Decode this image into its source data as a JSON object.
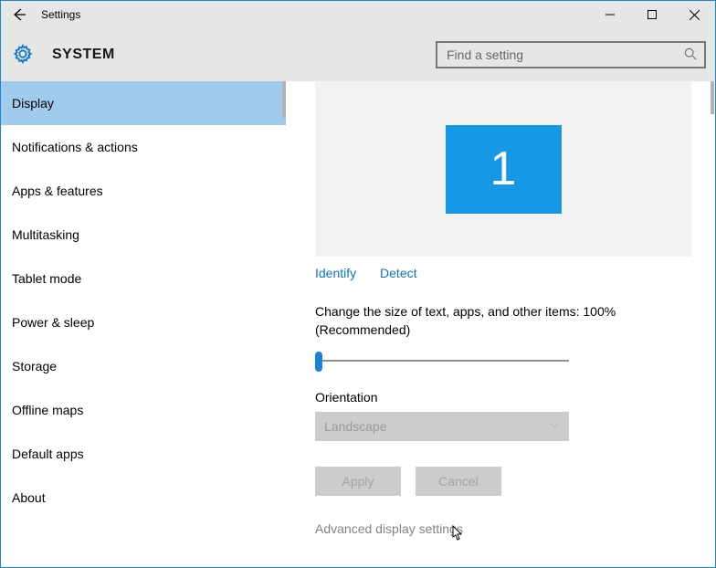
{
  "window": {
    "title": "Settings"
  },
  "header": {
    "label": "SYSTEM",
    "search_placeholder": "Find a setting"
  },
  "sidebar": {
    "items": [
      {
        "label": "Display",
        "selected": true
      },
      {
        "label": "Notifications & actions",
        "selected": false
      },
      {
        "label": "Apps & features",
        "selected": false
      },
      {
        "label": "Multitasking",
        "selected": false
      },
      {
        "label": "Tablet mode",
        "selected": false
      },
      {
        "label": "Power & sleep",
        "selected": false
      },
      {
        "label": "Storage",
        "selected": false
      },
      {
        "label": "Offline maps",
        "selected": false
      },
      {
        "label": "Default apps",
        "selected": false
      },
      {
        "label": "About",
        "selected": false
      }
    ]
  },
  "content": {
    "monitor_number": "1",
    "identify": "Identify",
    "detect": "Detect",
    "scale_label": "Change the size of text, apps, and other items: 100% (Recommended)",
    "orientation_label": "Orientation",
    "orientation_value": "Landscape",
    "apply": "Apply",
    "cancel": "Cancel",
    "advanced": "Advanced display settings"
  }
}
